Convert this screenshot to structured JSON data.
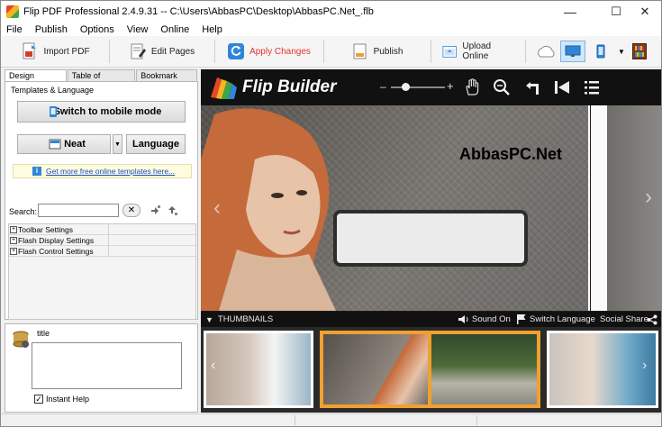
{
  "window": {
    "title": "Flip PDF Professional 2.4.9.31 -- C:\\Users\\AbbasPC\\Desktop\\AbbasPC.Net_.flb",
    "minimize": "—",
    "maximize": "☐",
    "close": "✕"
  },
  "menu": [
    "File",
    "Publish",
    "Options",
    "View",
    "Online",
    "Help"
  ],
  "toolbar": {
    "import_pdf": "Import PDF",
    "edit_pages": "Edit Pages",
    "apply_changes": "Apply Changes",
    "publish": "Publish",
    "upload_online": "Upload Online"
  },
  "tabs": [
    "Design Settings",
    "Table of Contents",
    "Bookmark Tabs"
  ],
  "design": {
    "section_label": "Templates & Language",
    "mobile_button": "Switch to mobile mode",
    "template_button": "Neat",
    "language_button": "Language",
    "more_templates_link": "Get more free online templates here...",
    "search_label": "Search:",
    "search_value": "",
    "tree_items": [
      "Toolbar Settings",
      "Flash Display Settings",
      "Flash Control Settings"
    ]
  },
  "help": {
    "title": "title",
    "instant_help_label": "Instant Help",
    "instant_help_checked": true
  },
  "viewer": {
    "brand": "Flip Builder",
    "page_text": "AbbasPC.Net",
    "zoom_minus": "–",
    "zoom_plus": "+",
    "zoom_level": 0.2,
    "thumbnails_label": "THUMBNAILS",
    "sound_label": "Sound On",
    "language_label": "Switch Language",
    "social_label": "Social Share"
  },
  "colors": {
    "apply_changes": "#e3342f",
    "link": "#1a4fc0",
    "viewer_bg": "#111111",
    "thumb_highlight": "#f0a030"
  }
}
